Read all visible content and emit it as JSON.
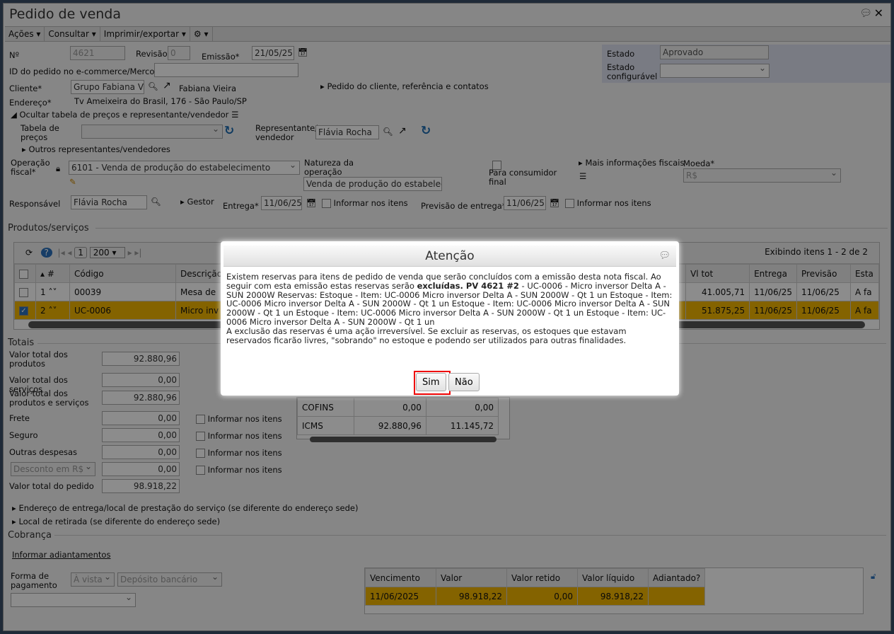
{
  "window": {
    "title": "Pedido de venda"
  },
  "toolbar": {
    "acoes": "Ações",
    "consultar": "Consultar",
    "imprimir": "Imprimir/exportar"
  },
  "form": {
    "numero_label": "Nº",
    "numero": "4621",
    "revisao_label": "Revisão",
    "revisao": "0",
    "emissao_label": "Emissão*",
    "emissao": "21/05/25",
    "estado_label": "Estado",
    "estado": "Aprovado",
    "estado_conf_label": "Estado configurável",
    "ecommerce_label": "ID do pedido no e-commerce/Mercos",
    "cliente_label": "Cliente*",
    "cliente": "Grupo Fabiana Vieira",
    "cliente_contato": "Fabiana Vieira",
    "pedido_cliente_link": "Pedido do cliente, referência e contatos",
    "endereco_label": "Endereço*",
    "endereco": "Tv Ameixeira do Brasil, 176 - São Paulo/SP",
    "ocultar_tabela": "Ocultar tabela de preços e representante/vendedor",
    "tabela_precos_label": "Tabela de preços",
    "representante_label": "Representante/ vendedor",
    "representante": "Flávia Rocha",
    "outros_representantes": "Outros representantes/vendedores",
    "operacao_label": "Operação fiscal*",
    "operacao": "6101 - Venda de produção do estabelecimento",
    "natureza_label": "Natureza da operação",
    "natureza": "Venda de produção do estabelecimento",
    "consumidor_final_label": "Para consumidor final",
    "mais_info_fiscais": "Mais informações fiscais",
    "moeda_label": "Moeda*",
    "moeda": "R$",
    "responsavel_label": "Responsável",
    "responsavel": "Flávia Rocha",
    "gestor": "Gestor",
    "entrega_label": "Entrega*",
    "entrega": "11/06/25",
    "informar_itens": "Informar nos itens",
    "previsao_label": "Previsão de entrega*",
    "previsao": "11/06/25"
  },
  "produtos": {
    "section": "Produtos/serviços",
    "page": "1",
    "page_size": "200",
    "exibindo": "Exibindo itens 1 - 2 de 2",
    "columns": [
      "#",
      "Código",
      "Descrição",
      "Vl tot",
      "Entrega",
      "Previsão",
      "Esta"
    ],
    "rows": [
      {
        "n": "1",
        "codigo": "00039",
        "descricao": "Mesa de",
        "vltot": "41.005,71",
        "entrega": "11/06/25",
        "previsao": "11/06/25",
        "estado": "A fa"
      },
      {
        "n": "2",
        "codigo": "UC-0006",
        "descricao": "Micro inv",
        "vltot": "51.875,25",
        "entrega": "11/06/25",
        "previsao": "11/06/25",
        "estado": "A fa"
      }
    ]
  },
  "totais": {
    "section": "Totais",
    "items": [
      {
        "label": "Valor total dos produtos",
        "value": "92.880,96"
      },
      {
        "label": "Valor total dos serviços",
        "value": "0,00"
      },
      {
        "label": "Valor total dos produtos e serviços",
        "value": "92.880,96"
      },
      {
        "label": "Frete",
        "value": "0,00"
      },
      {
        "label": "Seguro",
        "value": "0,00"
      },
      {
        "label": "Outras despesas",
        "value": "0,00"
      },
      {
        "label": "Desconto em R$",
        "value": "0,00"
      },
      {
        "label": "Valor total do pedido",
        "value": "98.918,22"
      }
    ],
    "informar": "Informar nos itens",
    "impostos": [
      {
        "nome": "COFINS",
        "base": "0,00",
        "valor": "0,00"
      },
      {
        "nome": "ICMS",
        "base": "92.880,96",
        "valor": "11.145,72"
      }
    ]
  },
  "links": {
    "endereco_entrega": "Endereço de entrega/local de prestação do serviço (se diferente do endereço sede)",
    "local_retirada": "Local de retirada (se diferente do endereço sede)"
  },
  "cobranca": {
    "section": "Cobrança",
    "adiantamentos": "Informar adiantamentos",
    "forma_label": "Forma de pagamento",
    "forma": "À vista",
    "meio": "Depósito bancário",
    "columns": [
      "Vencimento",
      "Valor",
      "Valor retido",
      "Valor líquido",
      "Adiantado?"
    ],
    "row": {
      "vencimento": "11/06/2025",
      "valor": "98.918,22",
      "retido": "0,00",
      "liquido": "98.918,22",
      "adiantado": ""
    }
  },
  "dialog": {
    "title": "Atenção",
    "text1": "Existem reservas para itens de pedido de venda que serão concluídos com a emissão desta nota fiscal. Ao seguir com esta emissão estas reservas serão ",
    "bold": "excluídas. PV 4621 #2",
    "text2": " - UC-0006 - Micro inversor Delta A - SUN 2000W Reservas: Estoque - Item: UC-0006 Micro inversor Delta A - SUN 2000W - Qt 1 un Estoque - Item: UC-0006 Micro inversor Delta A - SUN 2000W - Qt 1 un Estoque - Item: UC-0006 Micro inversor Delta A - SUN 2000W - Qt 1 un Estoque - Item: UC-0006 Micro inversor Delta A - SUN 2000W - Qt 1 un Estoque - Item: UC-0006 Micro inversor Delta A - SUN 2000W - Qt 1 un",
    "text3": "A exclusão das reservas é uma ação irreversível. Se excluir as reservas, os estoques que estavam reservados ficarão livres, \"sobrando\" no estoque e podendo ser utilizados para outras finalidades.",
    "sim": "Sim",
    "nao": "Não"
  }
}
